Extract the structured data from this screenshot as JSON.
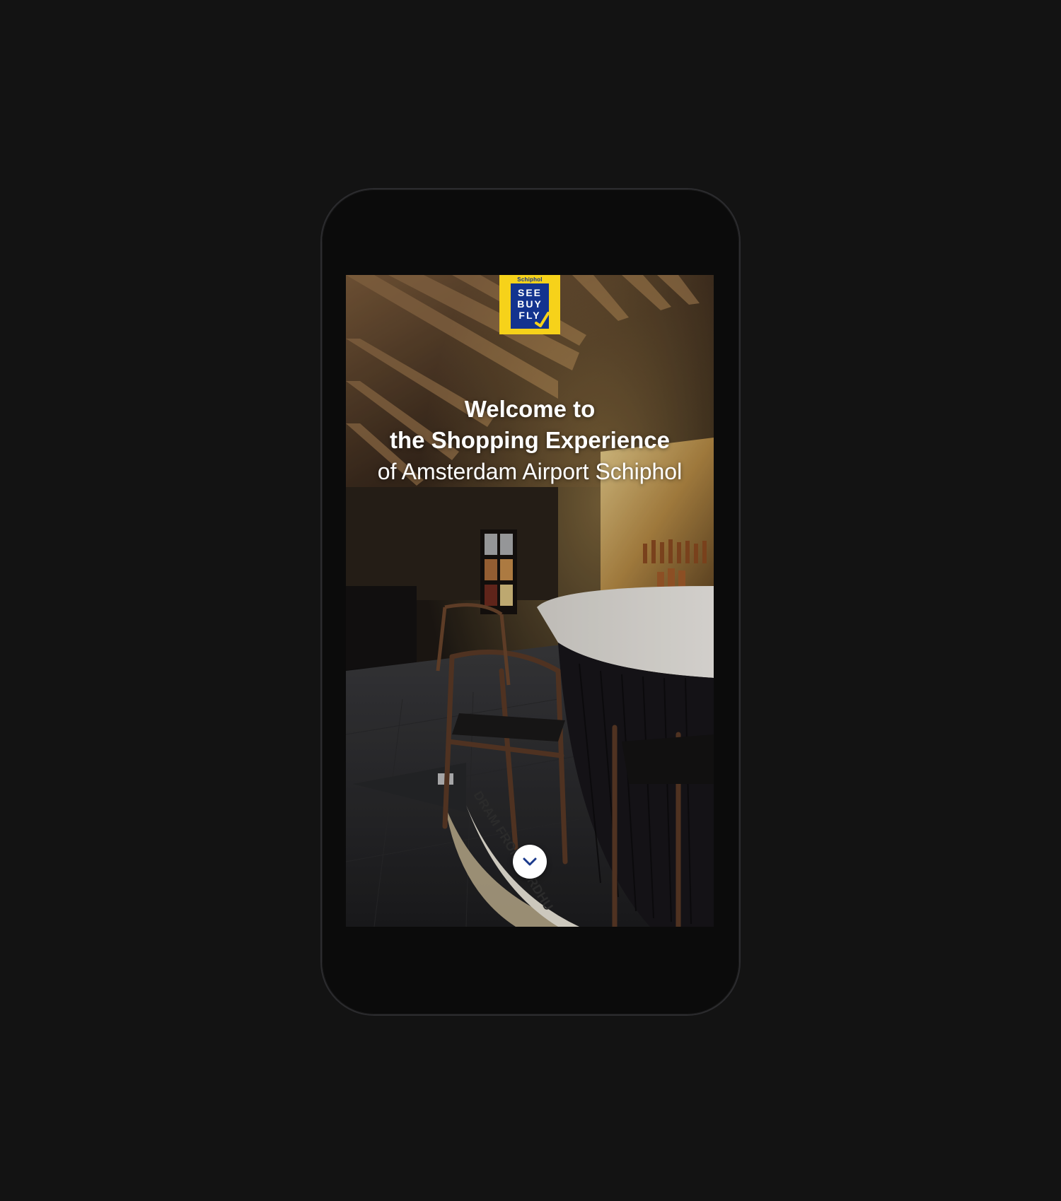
{
  "logo": {
    "brand": "Schiphol",
    "lines": [
      "SEE",
      "BUY",
      "FLY"
    ],
    "colors": {
      "background": "#f6d21a",
      "panel": "#13338f"
    }
  },
  "hero": {
    "title_line1": "Welcome to",
    "title_line2": "the Shopping Experience",
    "subtitle": "of Amsterdam Airport Schiphol",
    "floor_text": "DRAM FROM CARDHU"
  },
  "scroll_button": {
    "icon": "chevron-down-icon",
    "icon_color": "#1b3a8c"
  }
}
